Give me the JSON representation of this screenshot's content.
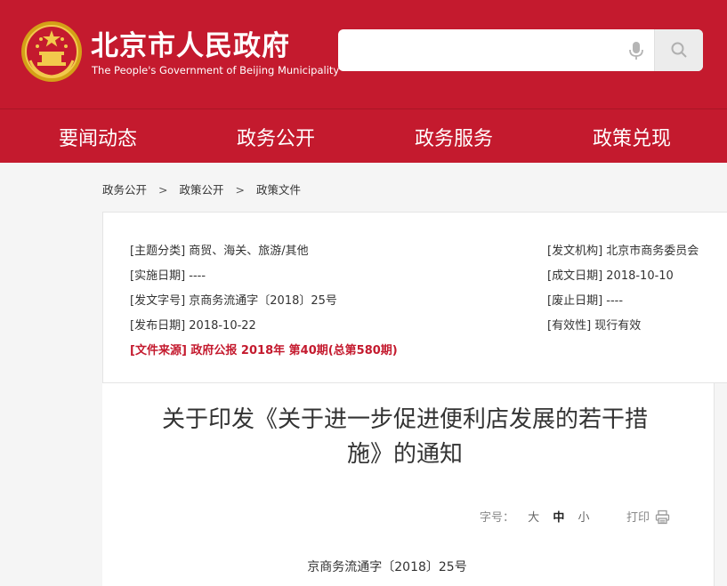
{
  "header": {
    "title": "北京市人民政府",
    "subtitle": "The People's Government of Beijing Municipality",
    "search_placeholder": ""
  },
  "nav": {
    "items": [
      "要闻动态",
      "政务公开",
      "政务服务",
      "政策兑现"
    ]
  },
  "breadcrumb": {
    "items": [
      "政务公开",
      "政策公开",
      "政策文件"
    ],
    "separator": ">"
  },
  "meta": {
    "subject": "[主题分类] 商贸、海关、旅游/其他",
    "issuer": "[发文机构] 北京市商务委员会",
    "effective_date": "[实施日期] ----",
    "created_date": "[成文日期] 2018-10-10",
    "doc_number": "[发文字号] 京商务流通字〔2018〕25号",
    "abolish_date": "[废止日期] ----",
    "publish_date": "[发布日期] 2018-10-22",
    "validity": "[有效性] 现行有效",
    "source": "[文件来源] 政府公报 2018年 第40期(总第580期)"
  },
  "article": {
    "title_line1": "关于印发《关于进一步促进便利店发展的若干措",
    "title_line2": "施》的通知",
    "font_size_label": "字号：",
    "font_large": "大",
    "font_medium": "中",
    "font_small": "小",
    "print_label": "打印",
    "doc_number": "京商务流通字〔2018〕25号"
  },
  "colors": {
    "brand_red": "#c41a2e",
    "source_red": "#c41a2e"
  },
  "icons": {
    "emblem": "national-emblem-icon",
    "mic": "microphone-icon",
    "search": "search-icon",
    "print": "printer-icon"
  }
}
